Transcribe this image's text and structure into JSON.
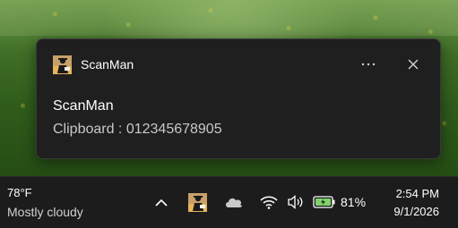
{
  "notification": {
    "app_name": "ScanMan",
    "title": "ScanMan",
    "body": "Clipboard : 012345678905",
    "icons": {
      "app": "scanman-app-icon",
      "more": "more-options-icon",
      "close": "close-icon"
    }
  },
  "taskbar": {
    "weather": {
      "temperature": "78°F",
      "condition": "Mostly cloudy"
    },
    "tray_icons": [
      "chevron-up-icon",
      "scanman-app-icon",
      "onedrive-cloud-icon",
      "wifi-icon",
      "volume-icon",
      "battery-charging-icon"
    ],
    "battery_percent": "81%",
    "clock": {
      "time": "2:54 PM",
      "date": "9/1/2026"
    }
  },
  "colors": {
    "toast_bg": "#1f1f1f",
    "taskbar_bg": "#1c1c1c",
    "battery_green": "#7fd36a"
  }
}
